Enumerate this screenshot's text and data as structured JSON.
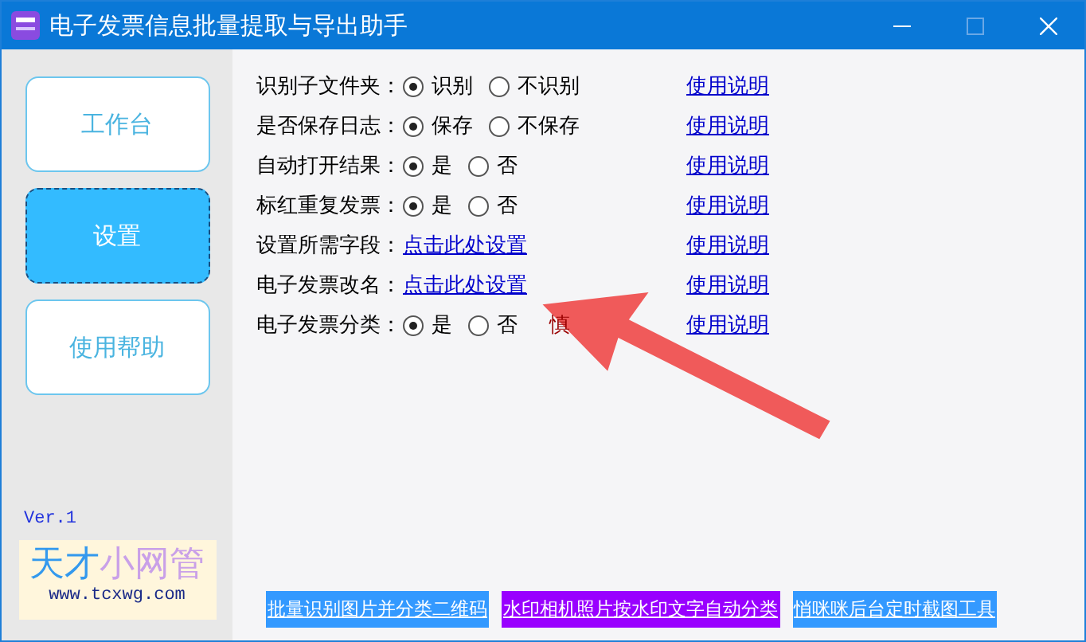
{
  "window": {
    "title": "电子发票信息批量提取与导出助手",
    "maximize_disabled": true
  },
  "sidebar": {
    "items": [
      {
        "label": "工作台",
        "selected": false
      },
      {
        "label": "设置",
        "selected": true
      },
      {
        "label": "使用帮助",
        "selected": false
      }
    ],
    "version": "Ver.1",
    "logo": {
      "part_1": "天才",
      "part_2": "小网管",
      "url": "www.tcxwg.com"
    }
  },
  "settings": [
    {
      "label": "识别子文件夹：",
      "kind": "radio",
      "options": [
        {
          "label": "识别",
          "selected": true
        },
        {
          "label": "不识别",
          "selected": false
        }
      ],
      "help": "使用说明"
    },
    {
      "label": "是否保存日志：",
      "kind": "radio",
      "options": [
        {
          "label": "保存",
          "selected": true
        },
        {
          "label": "不保存",
          "selected": false
        }
      ],
      "help": "使用说明"
    },
    {
      "label": "自动打开结果：",
      "kind": "radio",
      "options": [
        {
          "label": "是",
          "selected": true
        },
        {
          "label": "否",
          "selected": false
        }
      ],
      "help": "使用说明"
    },
    {
      "label": "标红重复发票：",
      "kind": "radio",
      "options": [
        {
          "label": "是",
          "selected": true
        },
        {
          "label": "否",
          "selected": false
        }
      ],
      "help": "使用说明"
    },
    {
      "label": "设置所需字段：",
      "kind": "link",
      "link": "点击此处设置",
      "help": "使用说明"
    },
    {
      "label": "电子发票改名：",
      "kind": "link",
      "link": "点击此处设置",
      "help": "使用说明"
    },
    {
      "label": "电子发票分类：",
      "kind": "radio",
      "options": [
        {
          "label": "是",
          "selected": true
        },
        {
          "label": "否",
          "selected": false
        }
      ],
      "note": "慎",
      "help": "使用说明"
    }
  ],
  "tool_links": [
    {
      "label": "批量识别图片并分类二维码",
      "color": "#3399ff"
    },
    {
      "label": "水印相机照片按水印文字自动分类",
      "color": "#9900ff"
    },
    {
      "label": "悄咪咪后台定时截图工具",
      "color": "#3399ff"
    }
  ]
}
